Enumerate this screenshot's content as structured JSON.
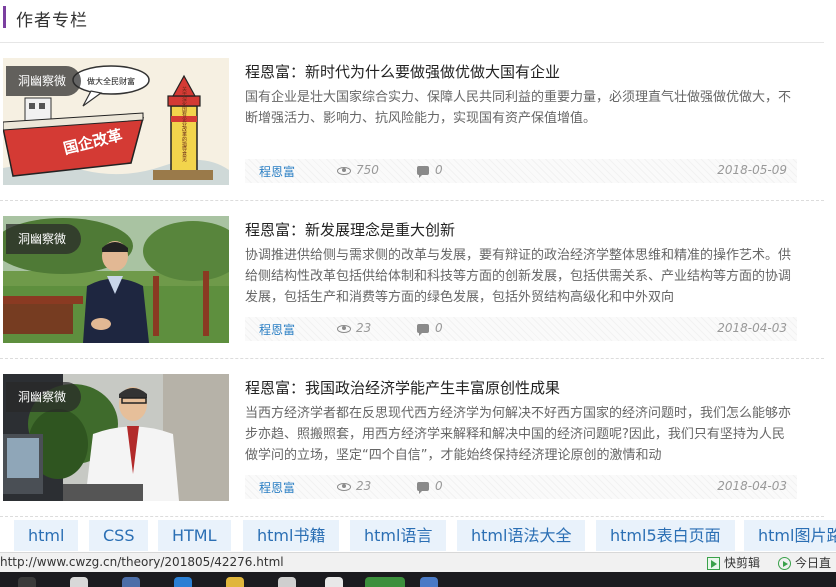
{
  "section": {
    "title": "作者专栏"
  },
  "articles": [
    {
      "tag": "洞幽察微",
      "title": "程恩富：新时代为什么要做强做优做大国有企业",
      "desc": "国有企业是壮大国家综合实力、保障人民共同利益的重要力量，必须理直气壮做强做优做大，不断增强活力、影响力、抗风险能力，实现国有资产保值增值。",
      "author": "程恩富",
      "views": "750",
      "comments": "0",
      "date": "2018-05-09",
      "cartoon": {
        "sign": "做大全民财富",
        "ship_text": "国企改革",
        "tower_text": "关于深化国有企业改革的指导意见"
      }
    },
    {
      "tag": "洞幽察微",
      "title": "程恩富：新发展理念是重大创新",
      "desc": "协调推进供给侧与需求侧的改革与发展，要有辩证的政治经济学整体思维和精准的操作艺术。供给侧结构性改革包括供给体制和科技等方面的创新发展，包括供需关系、产业结构等方面的协调发展，包括生产和消费等方面的绿色发展，包括外贸结构高级化和中外双向",
      "author": "程恩富",
      "views": "23",
      "comments": "0",
      "date": "2018-04-03"
    },
    {
      "tag": "洞幽察微",
      "title": "程恩富：我国政治经济学能产生丰富原创性成果",
      "desc": "当西方经济学者都在反思现代西方经济学为何解决不好西方国家的经济问题时，我们怎么能够亦步亦趋、照搬照套，用西方经济学来解释和解决中国的经济问题呢?因此，我们只有坚持为人民做学问的立场，坚定“四个自信”，才能始终保持经济理论原创的激情和动",
      "author": "程恩富",
      "views": "23",
      "comments": "0",
      "date": "2018-04-03"
    }
  ],
  "tags": [
    "html",
    "CSS",
    "HTML",
    "html书籍",
    "html语言",
    "html语法大全",
    "html5表白页面",
    "html图片路"
  ],
  "statusbar": {
    "url": "http://www.cwzg.cn/theory/201805/42276.html",
    "kuaijianji": "快剪辑",
    "today": "今日直"
  },
  "colors": {
    "accent": "#7b3fa0",
    "link": "#2b7fc4",
    "tag_bg": "#e9f2fb"
  }
}
